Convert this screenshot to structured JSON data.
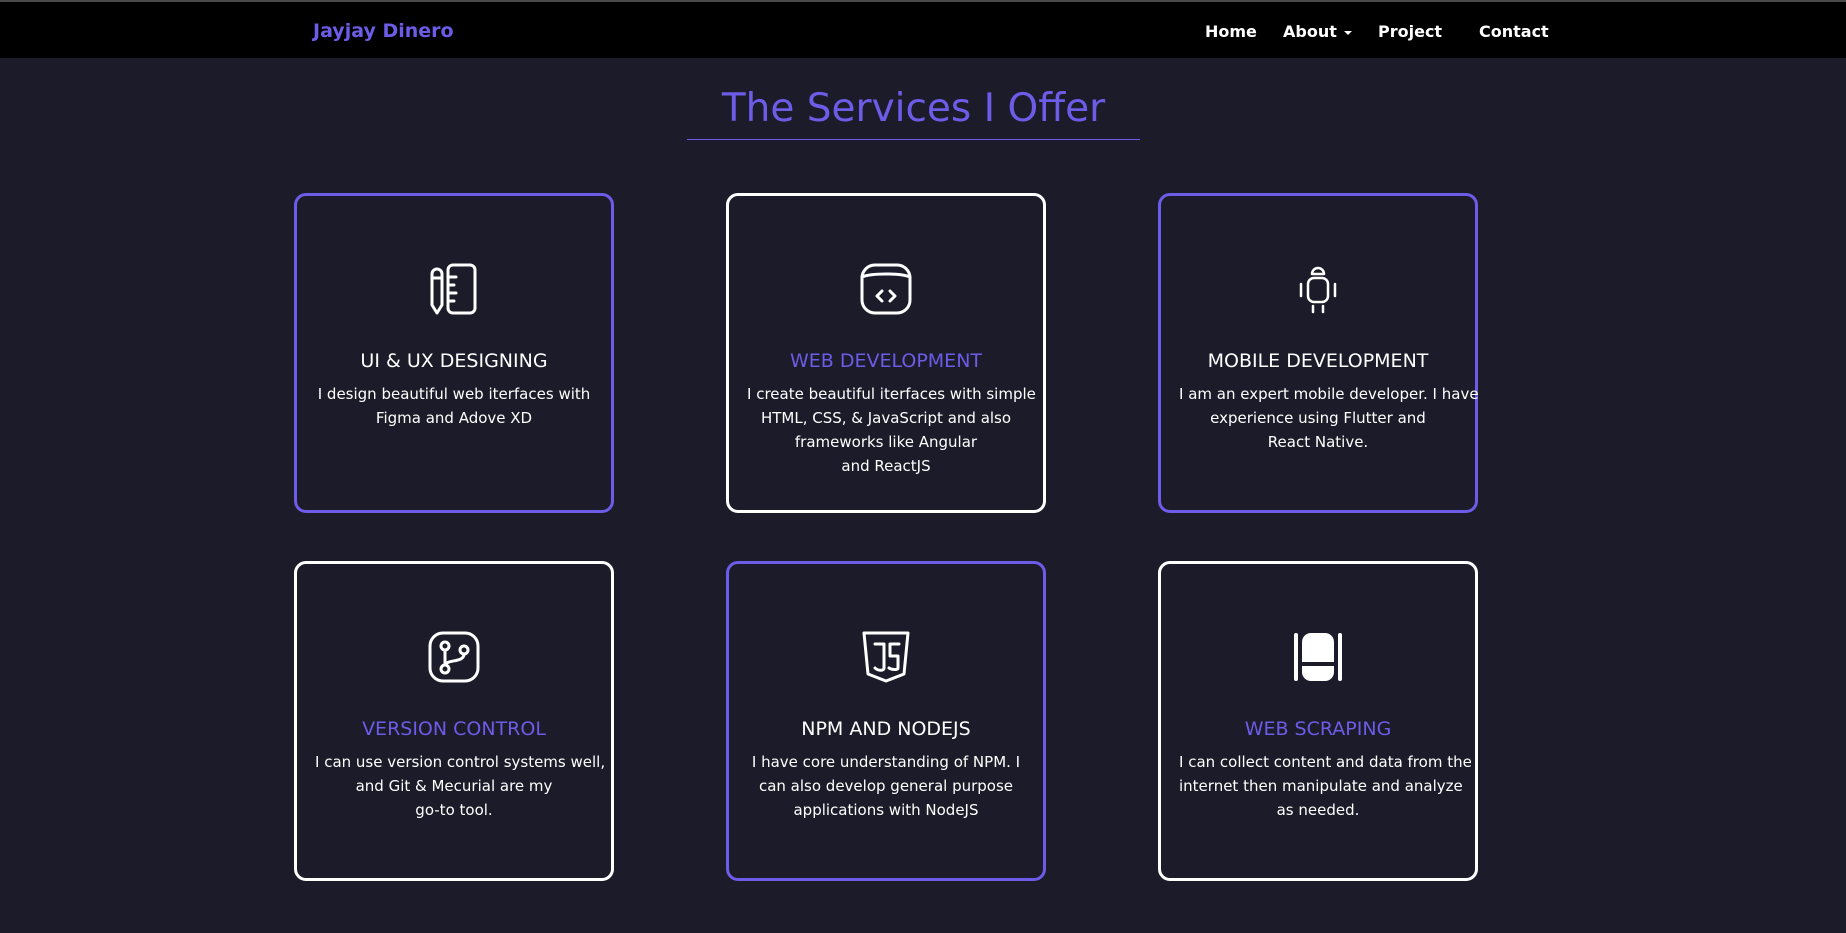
{
  "nav": {
    "brand": "Jayjay Dinero",
    "links": [
      "Home",
      "About",
      "Project",
      "Contact"
    ]
  },
  "section": {
    "title": "The Services I Offer"
  },
  "colors": {
    "accent": "#6c5ce7",
    "background": "#1c1b29",
    "navbar": "#000000",
    "text": "#ffffff"
  },
  "services": [
    {
      "icon": "pencil-ruler-icon",
      "title": "UI & UX DESIGNING",
      "lines": [
        "I design beautiful web iterfaces with",
        "Figma and Adove XD"
      ]
    },
    {
      "icon": "code-window-icon",
      "title": "WEB DEVELOPMENT",
      "lines": [
        "I create beautiful iterfaces with simple",
        "HTML, CSS, & JavaScript and also",
        "frameworks like Angular",
        "and ReactJS"
      ]
    },
    {
      "icon": "android-icon",
      "title": "MOBILE DEVELOPMENT",
      "lines": [
        "I am an expert mobile developer. I have",
        "experience using Flutter and",
        "React Native."
      ]
    },
    {
      "icon": "git-branch-icon",
      "title": "VERSION CONTROL",
      "lines": [
        "I can use version control systems well,",
        "and Git & Mecurial are my",
        "go-to tool."
      ]
    },
    {
      "icon": "javascript-icon",
      "title": "NPM AND NODEJS",
      "lines": [
        "I have core understanding of NPM. I",
        "can also develop general purpose",
        "applications with NodeJS"
      ]
    },
    {
      "icon": "web-scraping-icon",
      "title": "WEB SCRAPING",
      "lines": [
        "I can collect content and data from the",
        "internet then manipulate and analyze",
        "as needed."
      ]
    }
  ]
}
